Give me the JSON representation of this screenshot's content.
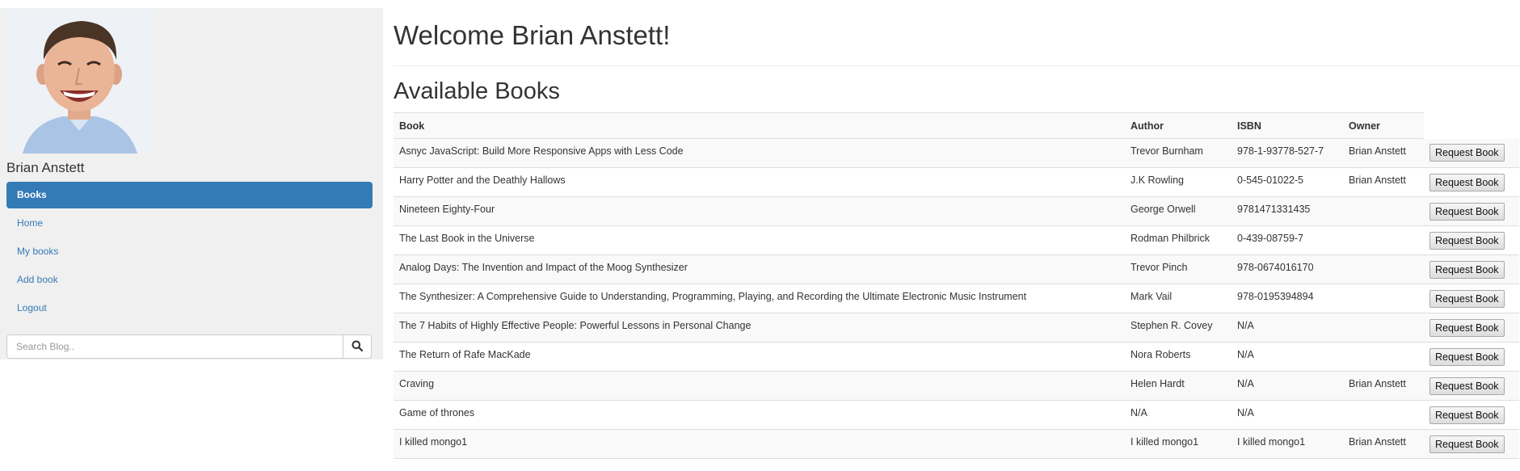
{
  "user": {
    "name": "Brian Anstett"
  },
  "sidebar": {
    "items": [
      {
        "label": "Books",
        "active": true
      },
      {
        "label": "Home",
        "active": false
      },
      {
        "label": "My books",
        "active": false
      },
      {
        "label": "Add book",
        "active": false
      },
      {
        "label": "Logout",
        "active": false
      }
    ],
    "search": {
      "placeholder": "Search Blog..",
      "icon": "search-icon"
    }
  },
  "main": {
    "heading": "Welcome Brian Anstett!",
    "subheading": "Available Books",
    "columns": [
      "Book",
      "Author",
      "ISBN",
      "Owner"
    ],
    "action_label": "Request Book",
    "rows": [
      {
        "book": "Asnyc JavaScript: Build More Responsive Apps with Less Code",
        "author": "Trevor Burnham",
        "isbn": "978-1-93778-527-7",
        "owner": "Brian Anstett"
      },
      {
        "book": "Harry Potter and the Deathly Hallows",
        "author": "J.K Rowling",
        "isbn": "0-545-01022-5",
        "owner": "Brian Anstett"
      },
      {
        "book": "Nineteen Eighty-Four",
        "author": "George Orwell",
        "isbn": "9781471331435",
        "owner": ""
      },
      {
        "book": "The Last Book in the Universe",
        "author": "Rodman Philbrick",
        "isbn": "0-439-08759-7",
        "owner": ""
      },
      {
        "book": "Analog Days: The Invention and Impact of the Moog Synthesizer",
        "author": "Trevor Pinch",
        "isbn": "978-0674016170",
        "owner": ""
      },
      {
        "book": "The Synthesizer: A Comprehensive Guide to Understanding, Programming, Playing, and Recording the Ultimate Electronic Music Instrument",
        "author": "Mark Vail",
        "isbn": "978-0195394894",
        "owner": ""
      },
      {
        "book": "The 7 Habits of Highly Effective People: Powerful Lessons in Personal Change",
        "author": "Stephen R. Covey",
        "isbn": "N/A",
        "owner": ""
      },
      {
        "book": "The Return of Rafe MacKade",
        "author": "Nora Roberts",
        "isbn": "N/A",
        "owner": ""
      },
      {
        "book": "Craving",
        "author": "Helen Hardt",
        "isbn": "N/A",
        "owner": "Brian Anstett"
      },
      {
        "book": "Game of thrones",
        "author": "N/A",
        "isbn": "N/A",
        "owner": ""
      },
      {
        "book": "I killed mongo1",
        "author": "I killed mongo1",
        "isbn": "I killed mongo1",
        "owner": "Brian Anstett"
      }
    ]
  },
  "colors": {
    "accent": "#337ab7",
    "sidebar_bg": "#f0f0f0",
    "stripe": "#f9f9f9"
  }
}
